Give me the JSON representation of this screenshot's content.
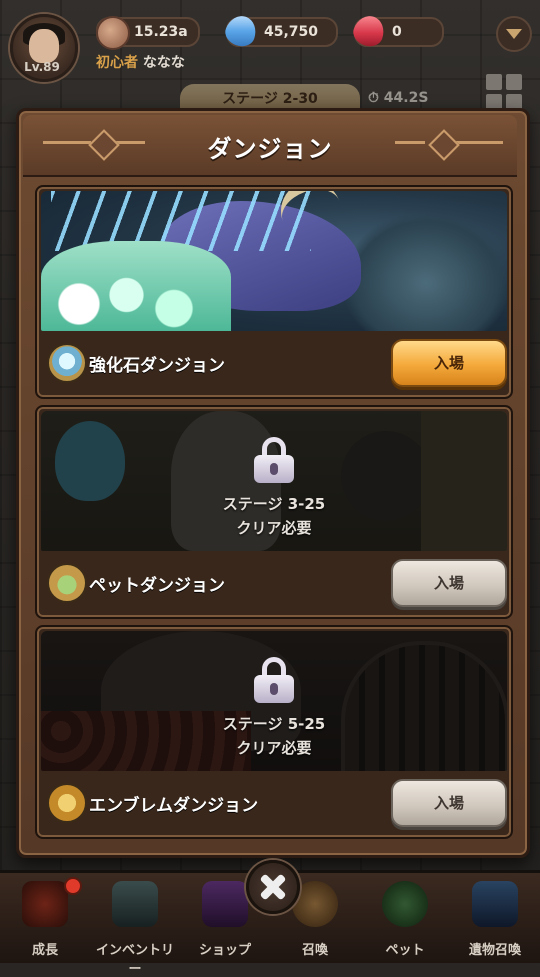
{
  "hud": {
    "level": "Lv.89",
    "nickname_title": "初心者",
    "nickname": "ななな",
    "currencies": [
      {
        "icon": "gold-coin-icon",
        "value": "15.23a"
      },
      {
        "icon": "blue-gem-icon",
        "value": "45,750"
      },
      {
        "icon": "red-gem-icon",
        "value": "0"
      }
    ],
    "stage": "ステージ 2-30",
    "timer": "44.2S"
  },
  "modal": {
    "title": "ダンジョン",
    "dungeons": [
      {
        "name": "強化石ダンジョン",
        "button": "入場",
        "locked": false,
        "emblem": "crystal-emblem-icon"
      },
      {
        "name": "ペットダンジョン",
        "button": "入場",
        "locked": true,
        "lock_line1": "ステージ 3-25",
        "lock_line2": "クリア必要",
        "emblem": "paw-emblem-icon"
      },
      {
        "name": "エンブレムダンジョン",
        "button": "入場",
        "locked": true,
        "lock_line1": "ステージ 5-25",
        "lock_line2": "クリア必要",
        "emblem": "emblem-medal-icon"
      }
    ]
  },
  "nav": {
    "items": [
      {
        "label": "成長",
        "icon": "growth-icon"
      },
      {
        "label": "インベントリー",
        "icon": "inventory-icon"
      },
      {
        "label": "ショップ",
        "icon": "shop-icon"
      },
      {
        "label": "召喚",
        "icon": "summon-icon"
      },
      {
        "label": "ペット",
        "icon": "pet-icon"
      },
      {
        "label": "遺物召喚",
        "icon": "relic-summon-icon"
      }
    ]
  },
  "colors": {
    "enter_active": "#f4a93a",
    "enter_locked": "#cfc6bb",
    "panel": "#6d4a31"
  }
}
